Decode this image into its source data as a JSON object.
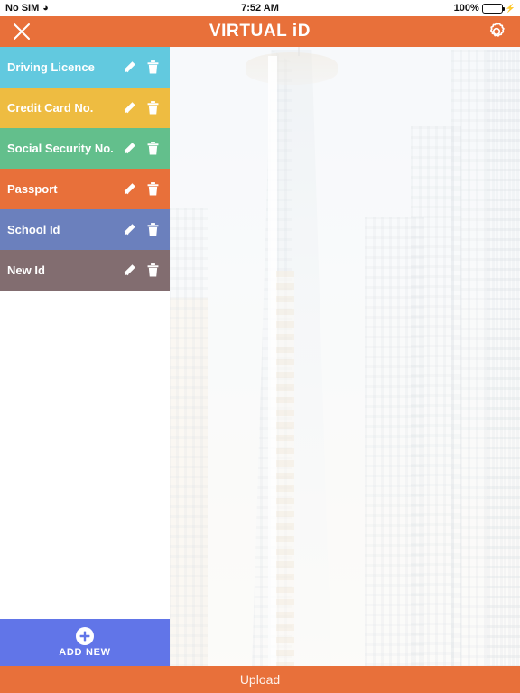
{
  "status_bar": {
    "carrier": "No SIM",
    "wifi_icon": "wifi-icon",
    "time": "7:52 AM",
    "battery_percent": "100%",
    "battery_level": 100,
    "charging": true,
    "battery_color": "#4cd964"
  },
  "header": {
    "title": "VIRTUAL iD",
    "close_icon": "close-icon",
    "settings_icon": "gear-icon",
    "background_color": "#e8703a",
    "text_color": "#ffffff"
  },
  "sidebar": {
    "edit_icon": "pencil-icon",
    "delete_icon": "trash-icon",
    "items": [
      {
        "label": "Driving Licence",
        "color": "#62c9df"
      },
      {
        "label": "Credit Card No.",
        "color": "#eebc41"
      },
      {
        "label": "Social Security No.",
        "color": "#63bf8c"
      },
      {
        "label": "Passport",
        "color": "#e8703a"
      },
      {
        "label": "School Id",
        "color": "#6b80bd"
      },
      {
        "label": "New Id",
        "color": "#826d70"
      }
    ]
  },
  "add_new_button": {
    "label": "ADD NEW",
    "icon": "plus-circle-icon",
    "background_color": "#6175e8"
  },
  "upload_bar": {
    "label": "Upload",
    "background_color": "#e8703a"
  },
  "background": {
    "description": "faded photograph of city skyscrapers"
  }
}
